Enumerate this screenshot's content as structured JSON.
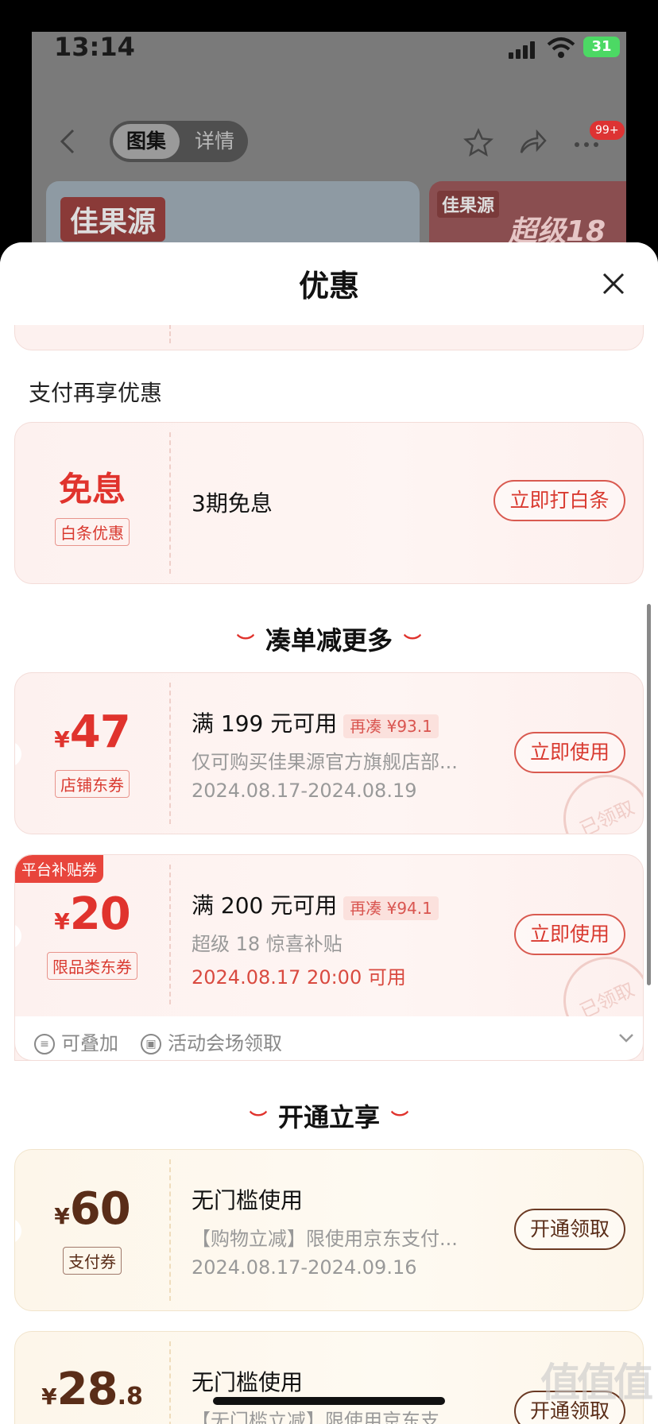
{
  "status_bar": {
    "time": "13:14",
    "battery": "31"
  },
  "nav": {
    "tabs": [
      {
        "label": "图集",
        "active": true
      },
      {
        "label": "详情",
        "active": false
      }
    ],
    "more_badge": "99+"
  },
  "banners": [
    {
      "logo": "佳果源"
    },
    {
      "logo": "佳果源",
      "text": "超级18"
    }
  ],
  "sheet": {
    "title": "优惠",
    "pay_section_label": "支付再享优惠",
    "baitiao": {
      "big": "免息",
      "tag": "白条优惠",
      "title": "3期免息",
      "button": "立即打白条"
    },
    "section_more": "凑单减更多",
    "coupons": [
      {
        "currency": "¥",
        "amount": "47",
        "tag": "店铺东券",
        "title": "满 199 元可用",
        "need": "再凑 ¥93.1",
        "desc": "仅可购买佳果源官方旗舰店部...",
        "date": "2024.08.17-2024.08.19",
        "button": "立即使用",
        "stamp": "已领取"
      },
      {
        "badge": "平台补贴券",
        "currency": "¥",
        "amount": "20",
        "tag": "限品类东券",
        "title": "满 200 元可用",
        "need": "再凑 ¥94.1",
        "desc": "超级 18 惊喜补贴",
        "date": "2024.08.17 20:00 可用",
        "button": "立即使用",
        "stamp": "已领取"
      }
    ],
    "coupon_footer": {
      "stackable": "可叠加",
      "source": "活动会场领取"
    },
    "section_open": "开通立享",
    "open_coupons": [
      {
        "currency": "¥",
        "amount": "60",
        "tag": "支付券",
        "title": "无门槛使用",
        "desc": "【购物立减】限使用京东支付...",
        "date": "2024.08.17-2024.09.16",
        "button": "开通领取"
      },
      {
        "currency": "¥",
        "amount": "28",
        "decimal": ".8",
        "title": "无门槛使用",
        "desc": "【无门槛立减】限使用京东支...",
        "button": "开通领取"
      }
    ]
  },
  "colors": {
    "accent": "#e0332d",
    "brown": "#5a2d18",
    "card_bg": "#fdf1ef",
    "gold_bg": "#fdf6ea"
  }
}
